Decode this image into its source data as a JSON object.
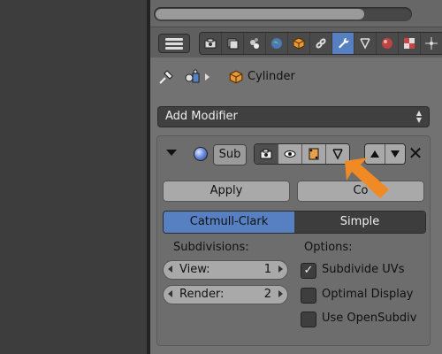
{
  "breadcrumb": {
    "object_name": "Cylinder"
  },
  "add_modifier": {
    "label": "Add Modifier"
  },
  "modifier": {
    "name": "Sub",
    "apply_label": "Apply",
    "copy_label": "Copy",
    "copy_visible": "Co",
    "algorithms": [
      "Catmull-Clark",
      "Simple"
    ],
    "subdivisions_label": "Subdivisions:",
    "view_label": "View:",
    "view_value": "1",
    "render_label": "Render:",
    "render_value": "2",
    "options_label": "Options:",
    "options": [
      {
        "label": "Subdivide UVs",
        "checked": true
      },
      {
        "label": "Optimal Display",
        "checked": false
      },
      {
        "label": "Use OpenSubdiv",
        "checked": false
      }
    ]
  },
  "icons": {
    "context_tabs": [
      "render-icon",
      "render-layers-icon",
      "scene-icon",
      "world-icon",
      "object-icon",
      "constraints-icon",
      "modifiers-wrench-icon",
      "data-mesh-icon",
      "material-icon",
      "texture-icon",
      "particles-icon"
    ],
    "visibility": [
      "render-camera-icon",
      "viewport-eye-icon",
      "edit-mode-icon",
      "cage-vertex-icon"
    ]
  },
  "colors": {
    "accent_blue": "#5680c2",
    "annotation_orange": "#f08a24"
  }
}
